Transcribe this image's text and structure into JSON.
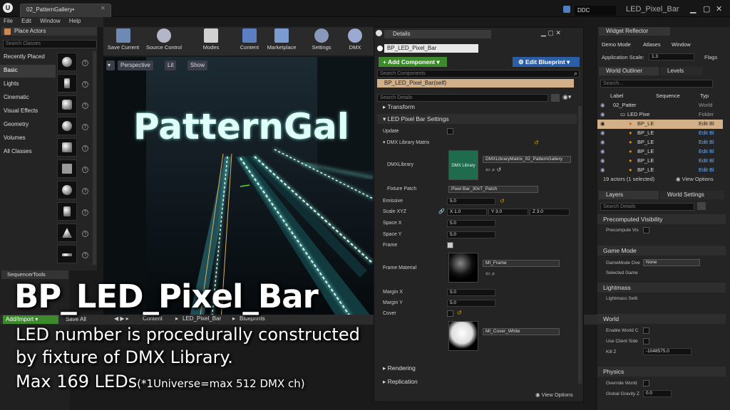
{
  "window": {
    "doc_tab": "02_PatternGallery•",
    "ddc_label": "DDC",
    "project_name": "LED_Pixel_Bar"
  },
  "menu": [
    "File",
    "Edit",
    "Window",
    "Help"
  ],
  "place_actors": {
    "title": "Place Actors",
    "search_placeholder": "Search Classes",
    "categories": [
      "Recently Placed",
      "Basic",
      "Lights",
      "Cinematic",
      "Visual Effects",
      "Geometry",
      "Volumes",
      "All Classes"
    ],
    "active_category": "Basic"
  },
  "toolbar": {
    "buttons": [
      "Save Current",
      "Source Control",
      "Modes",
      "Content",
      "Marketplace",
      "Settings",
      "DMX"
    ]
  },
  "viewport": {
    "perspective_label": "Perspective",
    "lit_label": "Lit",
    "show_label": "Show",
    "scene_text": "PatternGal"
  },
  "details": {
    "title": "Details",
    "actor_name": "BP_LED_Pixel_Bar",
    "add_component_label": "+ Add Component ▾",
    "edit_blueprint_label": "⚙ Edit Blueprint ▾",
    "search_components_placeholder": "Search Components",
    "self_row": "BP_LED_Pixel_Bar(self)",
    "search_details_placeholder": "Search Details",
    "transform_label": "Transform",
    "section_label": "LED Pixel Bar Settings",
    "update_label": "Update",
    "matrix_label": "DMX Library Matrix",
    "dmx_library_label": "DMXLibrary",
    "dmx_thumb_label": "DMX Library",
    "dmx_library_value": "DMXLibraryMatrix_02_PatternGallery",
    "fixture_patch_label": "Fixture Patch",
    "fixture_patch_value": "Pixel Bar_30xT_Patch",
    "emissive_label": "Emissive",
    "emissive_value": "5.0",
    "scale_label": "Scale XYZ",
    "scale_x": "1.0",
    "scale_y": "3.0",
    "scale_z": "3.0",
    "space_x_label": "Space X",
    "space_x_value": "5.0",
    "space_y_label": "Space Y",
    "space_y_value": "5.0",
    "frame_label": "Frame",
    "frame_material_label": "Frame Material",
    "frame_material_value": "MI_Frame",
    "margin_x_label": "Margin X",
    "margin_x_value": "5.0",
    "margin_y_label": "Margin Y",
    "margin_y_value": "5.0",
    "cover_label": "Cover",
    "cover_material_value": "MI_Cover_White",
    "rendering_label": "Rendering",
    "replication_label": "Replication",
    "view_options_label": "View Options"
  },
  "widget_reflector": {
    "title": "Widget Reflector",
    "items": [
      "Demo Mode",
      "Atlases",
      "Window"
    ],
    "app_scale_label": "Application Scale:",
    "app_scale_value": "1.3",
    "flags_label": "Flags"
  },
  "world_outliner": {
    "title": "World Outliner",
    "levels_tab": "Levels",
    "search_placeholder": "Search...",
    "col_label": "Label",
    "col_sequence": "Sequence",
    "col_type": "Typ",
    "rows": [
      {
        "label": "02_Patter",
        "type": "World"
      },
      {
        "label": "LED Pixe",
        "type": "Folder"
      },
      {
        "label": "BP_LE",
        "type": "Edit Bl"
      },
      {
        "label": "BP_LE",
        "type": "Edit Bl"
      },
      {
        "label": "BP_LE",
        "type": "Edit Bl"
      },
      {
        "label": "BP_LE",
        "type": "Edit Bl"
      },
      {
        "label": "BP_LE",
        "type": "Edit Bl"
      },
      {
        "label": "BP_LE",
        "type": "Edit Bl"
      }
    ],
    "footer": "19 actors (1 selected)",
    "view_options": "View Options"
  },
  "layers": {
    "title": "Layers",
    "world_settings_tab": "World Settings",
    "search_placeholder": "Search Details",
    "sections": {
      "precomputed_visibility": "Precomputed Visibility",
      "precompute_vis": "Precompute Vis",
      "game_mode": "Game Mode",
      "gamemode_override": "GameMode Ove",
      "gamemode_value": "None",
      "selected_game": "Selected Game",
      "lightmass": "Lightmass",
      "lightmass_settings": "Lightmass Setti",
      "world": "World",
      "enable_world": "Enable World C",
      "use_client_side": "Use Client Side",
      "kill_z": "Kill Z",
      "kill_z_value": "-1048575.0",
      "physics": "Physics",
      "override_world": "Override World",
      "global_gravity": "Global Gravity Z",
      "global_gravity_value": "0.0"
    }
  },
  "sequencer": {
    "title": "SequencerTools"
  },
  "content_browser": {
    "add_import_label": "Add/Import ▾",
    "save_all_label": "Save All",
    "breadcrumbs": [
      "Content",
      "LED_Pixel_Bar",
      "Blueprints"
    ]
  },
  "caption": {
    "title": "BP_LED_Pixel_Bar",
    "line1": "LED number is procedurally constructed",
    "line2": "by fixture of DMX Library.",
    "line3_main": "Max 169 LEDs",
    "line3_note": "(*1Universe=max 512 DMX ch)"
  },
  "colors": {
    "selection": "#d2b18a",
    "add_component": "#3d8a2c",
    "edit_blueprint": "#2a5fa8",
    "led_glow": "#7ff0e0"
  }
}
